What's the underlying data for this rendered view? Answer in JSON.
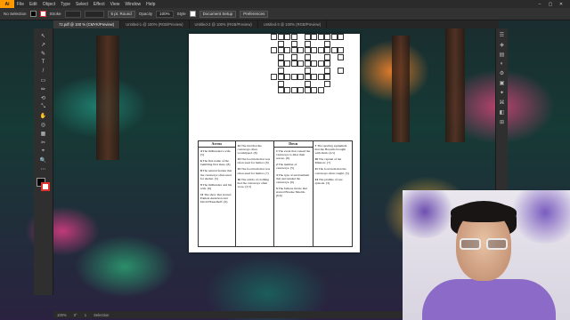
{
  "app": {
    "logo": "Ai",
    "menus": [
      "File",
      "Edit",
      "Object",
      "Type",
      "Select",
      "Effect",
      "View",
      "Window",
      "Help"
    ]
  },
  "controlbar": {
    "selection_label": "No Selection",
    "stroke_label": "Stroke",
    "stroke_value": "",
    "brush_label": "5 pt. Round",
    "opacity_label": "Opacity",
    "opacity_value": "100%",
    "style_label": "Style",
    "document_setup": "Document Setup",
    "preferences": "Preferences"
  },
  "tabs": [
    {
      "label": "72.pdf @ 100 % (CMYK/Preview)",
      "active": true
    },
    {
      "label": "Untitled-1 @ 100% (RGB/Preview)",
      "active": false
    },
    {
      "label": "Untitled-2 @ 100% (RGB/Preview)",
      "active": false
    },
    {
      "label": "Untitled-3 @ 100% (RGB/Preview)",
      "active": false
    }
  ],
  "tools": [
    "↖",
    "↗",
    "✎",
    "T",
    "/",
    "▭",
    "✏",
    "⟲",
    "⤡",
    "✋",
    "◎",
    "▦",
    "✂",
    "⌖",
    "🔍",
    "⋯"
  ],
  "right_tools": [
    "☰",
    "◈",
    "▤",
    "◐",
    "⚙",
    "▣",
    "✦",
    "⌘",
    "◧",
    "⊞"
  ],
  "status": {
    "zoom": "100%",
    "rotation": "0°",
    "artboard": "1",
    "tool": "Selection"
  },
  "crossword": {
    "across_header": "Across",
    "down_header": "Down",
    "across": [
      {
        "num": "4",
        "text": "The millionaire's wife. (5)"
      },
      {
        "num": "6",
        "text": "The first name of the bumbling first mate. (8)"
      },
      {
        "num": "8",
        "text": "The natural feature that the castaways often used for shelter. (5)"
      },
      {
        "num": "9",
        "text": "The millionaire and his wife. (6)"
      },
      {
        "num": "11",
        "text": "The show that starred Pamela Anderson and David Hasselhoff. (6)"
      }
    ],
    "across2": [
      {
        "num": "12",
        "text": "The idol that the castaways often worshipped. (8)"
      },
      {
        "num": "13",
        "text": "The food item that was often used for humor. (8)"
      },
      {
        "num": "15",
        "text": "The food item that was often used for humor. (7)"
      },
      {
        "num": "16",
        "text": "The article of clothing that the castaways often wore. (3,5)"
      }
    ],
    "down": [
      {
        "num": "1",
        "text": "The event that caused the castaways to miss their rescue. (8)"
      },
      {
        "num": "2",
        "text": "The number of castaways. (5)"
      },
      {
        "num": "3",
        "text": "The type of environment that surrounded the castaways. (6)"
      },
      {
        "num": "5",
        "text": "The famous movie that starred Brooke Shields. (6,6)"
      }
    ],
    "down2": [
      {
        "num": "7",
        "text": "The sporting equipment that the Howells brought with them. (4,5)"
      },
      {
        "num": "10",
        "text": "The captain of the Minnow. (7)"
      },
      {
        "num": "11",
        "text": "The food item that the castaways often caught. (5)"
      },
      {
        "num": "14",
        "text": "The plotline of one episode. (3)"
      }
    ]
  }
}
